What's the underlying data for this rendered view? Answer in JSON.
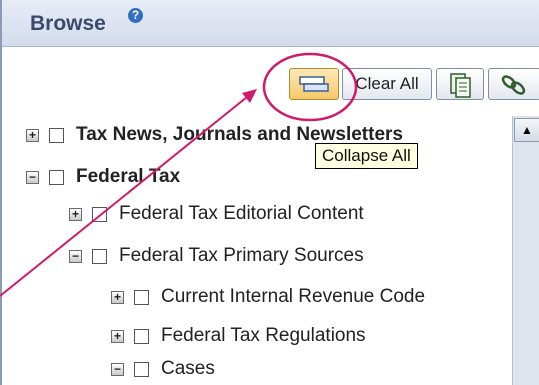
{
  "header": {
    "title": "Browse",
    "help_glyph": "?"
  },
  "toolbar": {
    "collapse_icon": "collapse-all-icon",
    "clear_all_label": "Clear All",
    "copy_icon": "copy-documents-icon",
    "link_icon": "link-icon"
  },
  "tooltip": {
    "text": "Collapse All"
  },
  "tree": {
    "items": [
      {
        "label": "Tax News, Journals and Newsletters",
        "expander": "+",
        "bold": true
      },
      {
        "label": "Federal Tax",
        "expander": "−",
        "bold": true
      },
      {
        "label": "Federal Tax Editorial Content",
        "expander": "+",
        "bold": false
      },
      {
        "label": "Federal Tax Primary Sources",
        "expander": "−",
        "bold": false
      },
      {
        "label": "Current Internal Revenue Code",
        "expander": "+",
        "bold": false
      },
      {
        "label": "Federal Tax Regulations",
        "expander": "+",
        "bold": false
      },
      {
        "label": "Cases",
        "expander": "−",
        "bold": false
      }
    ]
  },
  "scrollbar": {
    "up_glyph": "▲"
  },
  "colors": {
    "highlight_circle": "#d11a6b",
    "header_bg": "#dde4f1",
    "title": "#3a4a6b"
  }
}
